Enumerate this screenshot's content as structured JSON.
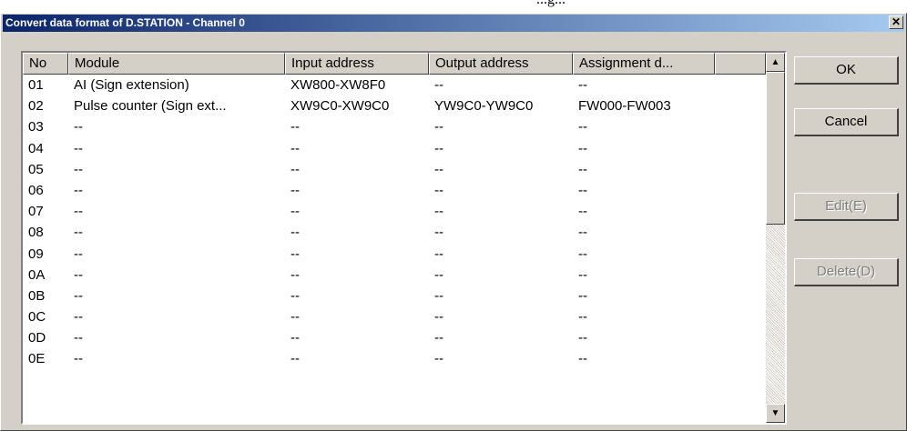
{
  "page": {
    "top_fragment": "...g..."
  },
  "dialog": {
    "title": "Convert data format of D.STATION - Channel 0",
    "close_glyph": "✕"
  },
  "table": {
    "columns": [
      "No",
      "Module",
      "Input address",
      "Output address",
      "Assignment d..."
    ],
    "rows": [
      [
        "01",
        "AI (Sign extension)",
        "XW800-XW8F0",
        "--",
        "--"
      ],
      [
        "02",
        "Pulse counter (Sign ext...",
        "XW9C0-XW9C0",
        "YW9C0-YW9C0",
        "FW000-FW003"
      ],
      [
        "03",
        "--",
        "--",
        "--",
        "--"
      ],
      [
        "04",
        "--",
        "--",
        "--",
        "--"
      ],
      [
        "05",
        "--",
        "--",
        "--",
        "--"
      ],
      [
        "06",
        "--",
        "--",
        "--",
        "--"
      ],
      [
        "07",
        "--",
        "--",
        "--",
        "--"
      ],
      [
        "08",
        "--",
        "--",
        "--",
        "--"
      ],
      [
        "09",
        "--",
        "--",
        "--",
        "--"
      ],
      [
        "0A",
        "--",
        "--",
        "--",
        "--"
      ],
      [
        "0B",
        "--",
        "--",
        "--",
        "--"
      ],
      [
        "0C",
        "--",
        "--",
        "--",
        "--"
      ],
      [
        "0D",
        "--",
        "--",
        "--",
        "--"
      ],
      [
        "0E",
        "--",
        "--",
        "--",
        "--"
      ]
    ]
  },
  "scrollbar": {
    "up_glyph": "▲",
    "down_glyph": "▼"
  },
  "buttons": {
    "ok": "OK",
    "cancel": "Cancel",
    "edit": "Edit(E)",
    "delete": "Delete(D)"
  },
  "icons": {
    "close": "close-icon",
    "scroll_up": "arrow-up-icon",
    "scroll_down": "arrow-down-icon"
  },
  "colors": {
    "titlebar_start": "#0a246a",
    "titlebar_end": "#a6caf0",
    "face": "#d4d0c8",
    "disabled_text": "#808080"
  }
}
